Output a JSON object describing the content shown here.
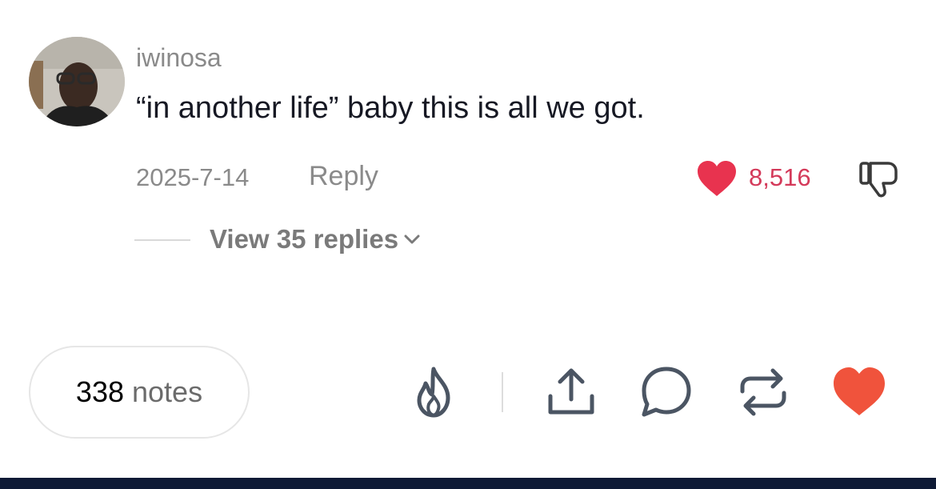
{
  "comment": {
    "username": "iwinosa",
    "text": "“in another life” baby this is all we got.",
    "date": "2025-7-14",
    "reply_label": "Reply",
    "like_count": "8,516",
    "view_replies_label": "View 35 replies"
  },
  "footer": {
    "notes_count": "338",
    "notes_label": "notes",
    "actions": [
      "flame-icon",
      "share-icon",
      "comment-icon",
      "reblog-icon",
      "heart-icon"
    ]
  },
  "colors": {
    "tiktok_heart": "#e8334f",
    "like_count": "#d43a5a",
    "tumblr_heart": "#f0533c",
    "icon_stroke": "#4b5563",
    "bottom_bar": "#0e1a35"
  }
}
